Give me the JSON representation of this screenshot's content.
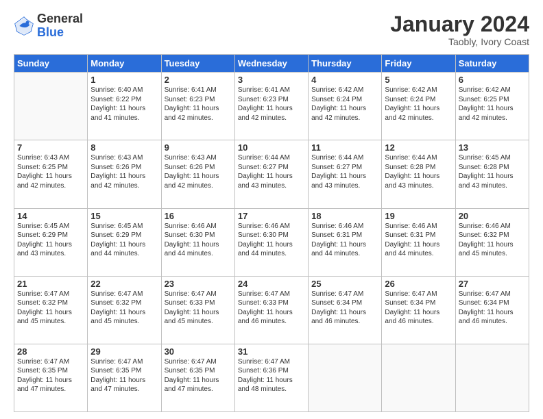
{
  "header": {
    "logo_general": "General",
    "logo_blue": "Blue",
    "month_title": "January 2024",
    "subtitle": "Taobly, Ivory Coast"
  },
  "weekdays": [
    "Sunday",
    "Monday",
    "Tuesday",
    "Wednesday",
    "Thursday",
    "Friday",
    "Saturday"
  ],
  "weeks": [
    [
      {
        "day": "",
        "lines": []
      },
      {
        "day": "1",
        "lines": [
          "Sunrise: 6:40 AM",
          "Sunset: 6:22 PM",
          "Daylight: 11 hours",
          "and 41 minutes."
        ]
      },
      {
        "day": "2",
        "lines": [
          "Sunrise: 6:41 AM",
          "Sunset: 6:23 PM",
          "Daylight: 11 hours",
          "and 42 minutes."
        ]
      },
      {
        "day": "3",
        "lines": [
          "Sunrise: 6:41 AM",
          "Sunset: 6:23 PM",
          "Daylight: 11 hours",
          "and 42 minutes."
        ]
      },
      {
        "day": "4",
        "lines": [
          "Sunrise: 6:42 AM",
          "Sunset: 6:24 PM",
          "Daylight: 11 hours",
          "and 42 minutes."
        ]
      },
      {
        "day": "5",
        "lines": [
          "Sunrise: 6:42 AM",
          "Sunset: 6:24 PM",
          "Daylight: 11 hours",
          "and 42 minutes."
        ]
      },
      {
        "day": "6",
        "lines": [
          "Sunrise: 6:42 AM",
          "Sunset: 6:25 PM",
          "Daylight: 11 hours",
          "and 42 minutes."
        ]
      }
    ],
    [
      {
        "day": "7",
        "lines": [
          "Sunrise: 6:43 AM",
          "Sunset: 6:25 PM",
          "Daylight: 11 hours",
          "and 42 minutes."
        ]
      },
      {
        "day": "8",
        "lines": [
          "Sunrise: 6:43 AM",
          "Sunset: 6:26 PM",
          "Daylight: 11 hours",
          "and 42 minutes."
        ]
      },
      {
        "day": "9",
        "lines": [
          "Sunrise: 6:43 AM",
          "Sunset: 6:26 PM",
          "Daylight: 11 hours",
          "and 42 minutes."
        ]
      },
      {
        "day": "10",
        "lines": [
          "Sunrise: 6:44 AM",
          "Sunset: 6:27 PM",
          "Daylight: 11 hours",
          "and 43 minutes."
        ]
      },
      {
        "day": "11",
        "lines": [
          "Sunrise: 6:44 AM",
          "Sunset: 6:27 PM",
          "Daylight: 11 hours",
          "and 43 minutes."
        ]
      },
      {
        "day": "12",
        "lines": [
          "Sunrise: 6:44 AM",
          "Sunset: 6:28 PM",
          "Daylight: 11 hours",
          "and 43 minutes."
        ]
      },
      {
        "day": "13",
        "lines": [
          "Sunrise: 6:45 AM",
          "Sunset: 6:28 PM",
          "Daylight: 11 hours",
          "and 43 minutes."
        ]
      }
    ],
    [
      {
        "day": "14",
        "lines": [
          "Sunrise: 6:45 AM",
          "Sunset: 6:29 PM",
          "Daylight: 11 hours",
          "and 43 minutes."
        ]
      },
      {
        "day": "15",
        "lines": [
          "Sunrise: 6:45 AM",
          "Sunset: 6:29 PM",
          "Daylight: 11 hours",
          "and 44 minutes."
        ]
      },
      {
        "day": "16",
        "lines": [
          "Sunrise: 6:46 AM",
          "Sunset: 6:30 PM",
          "Daylight: 11 hours",
          "and 44 minutes."
        ]
      },
      {
        "day": "17",
        "lines": [
          "Sunrise: 6:46 AM",
          "Sunset: 6:30 PM",
          "Daylight: 11 hours",
          "and 44 minutes."
        ]
      },
      {
        "day": "18",
        "lines": [
          "Sunrise: 6:46 AM",
          "Sunset: 6:31 PM",
          "Daylight: 11 hours",
          "and 44 minutes."
        ]
      },
      {
        "day": "19",
        "lines": [
          "Sunrise: 6:46 AM",
          "Sunset: 6:31 PM",
          "Daylight: 11 hours",
          "and 44 minutes."
        ]
      },
      {
        "day": "20",
        "lines": [
          "Sunrise: 6:46 AM",
          "Sunset: 6:32 PM",
          "Daylight: 11 hours",
          "and 45 minutes."
        ]
      }
    ],
    [
      {
        "day": "21",
        "lines": [
          "Sunrise: 6:47 AM",
          "Sunset: 6:32 PM",
          "Daylight: 11 hours",
          "and 45 minutes."
        ]
      },
      {
        "day": "22",
        "lines": [
          "Sunrise: 6:47 AM",
          "Sunset: 6:32 PM",
          "Daylight: 11 hours",
          "and 45 minutes."
        ]
      },
      {
        "day": "23",
        "lines": [
          "Sunrise: 6:47 AM",
          "Sunset: 6:33 PM",
          "Daylight: 11 hours",
          "and 45 minutes."
        ]
      },
      {
        "day": "24",
        "lines": [
          "Sunrise: 6:47 AM",
          "Sunset: 6:33 PM",
          "Daylight: 11 hours",
          "and 46 minutes."
        ]
      },
      {
        "day": "25",
        "lines": [
          "Sunrise: 6:47 AM",
          "Sunset: 6:34 PM",
          "Daylight: 11 hours",
          "and 46 minutes."
        ]
      },
      {
        "day": "26",
        "lines": [
          "Sunrise: 6:47 AM",
          "Sunset: 6:34 PM",
          "Daylight: 11 hours",
          "and 46 minutes."
        ]
      },
      {
        "day": "27",
        "lines": [
          "Sunrise: 6:47 AM",
          "Sunset: 6:34 PM",
          "Daylight: 11 hours",
          "and 46 minutes."
        ]
      }
    ],
    [
      {
        "day": "28",
        "lines": [
          "Sunrise: 6:47 AM",
          "Sunset: 6:35 PM",
          "Daylight: 11 hours",
          "and 47 minutes."
        ]
      },
      {
        "day": "29",
        "lines": [
          "Sunrise: 6:47 AM",
          "Sunset: 6:35 PM",
          "Daylight: 11 hours",
          "and 47 minutes."
        ]
      },
      {
        "day": "30",
        "lines": [
          "Sunrise: 6:47 AM",
          "Sunset: 6:35 PM",
          "Daylight: 11 hours",
          "and 47 minutes."
        ]
      },
      {
        "day": "31",
        "lines": [
          "Sunrise: 6:47 AM",
          "Sunset: 6:36 PM",
          "Daylight: 11 hours",
          "and 48 minutes."
        ]
      },
      {
        "day": "",
        "lines": []
      },
      {
        "day": "",
        "lines": []
      },
      {
        "day": "",
        "lines": []
      }
    ]
  ]
}
